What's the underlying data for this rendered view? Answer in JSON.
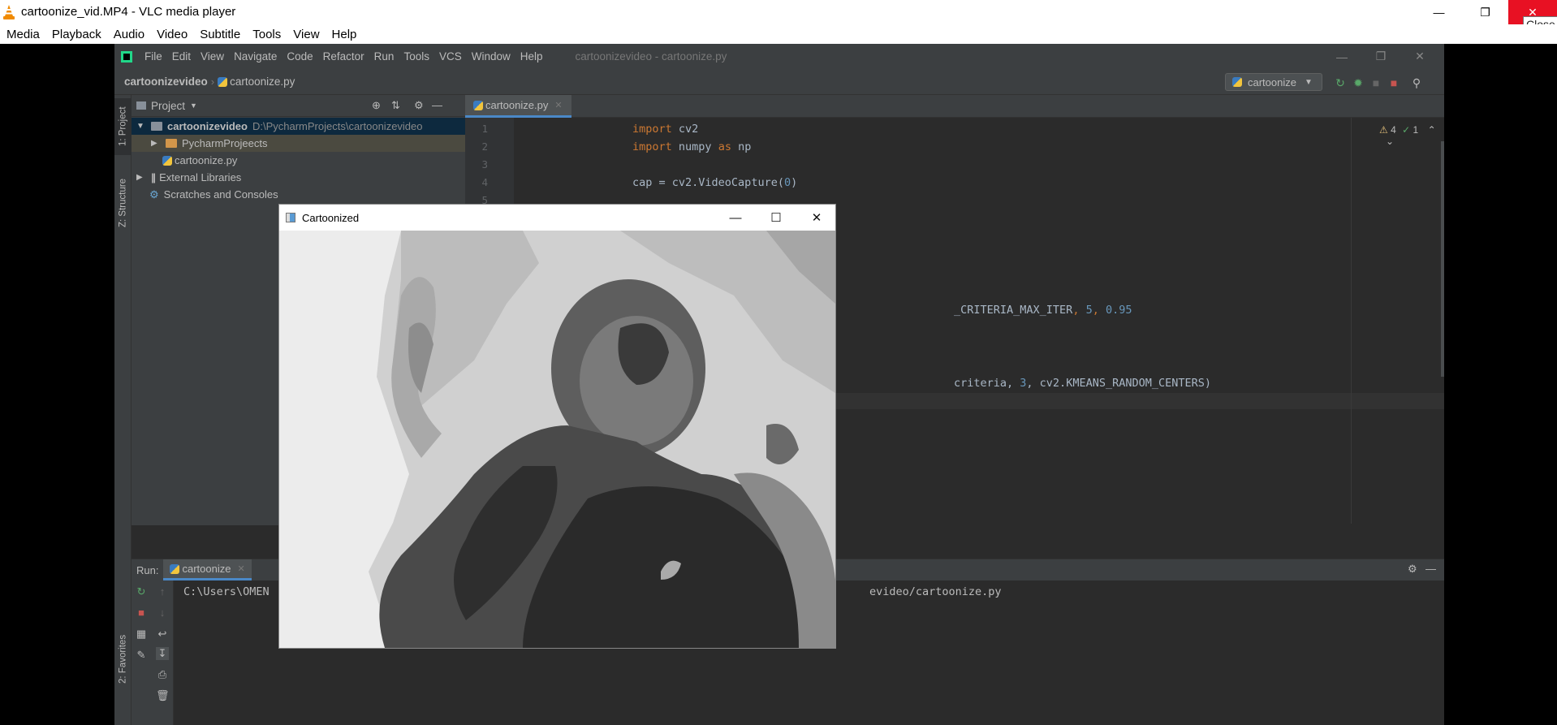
{
  "vlc": {
    "title": "cartoonize_vid.MP4 - VLC media player",
    "close_tooltip": "Close",
    "menu": [
      "Media",
      "Playback",
      "Audio",
      "Video",
      "Subtitle",
      "Tools",
      "View",
      "Help"
    ]
  },
  "pycharm": {
    "menu": [
      "File",
      "Edit",
      "View",
      "Navigate",
      "Code",
      "Refactor",
      "Run",
      "Tools",
      "VCS",
      "Window",
      "Help"
    ],
    "window_title": "cartoonizevideo - cartoonize.py",
    "breadcrumb": {
      "project": "cartoonizevideo",
      "file": "cartoonize.py"
    },
    "run_config": "cartoonize",
    "side_tabs": {
      "project": "1: Project",
      "structure": "Z: Structure",
      "favorites": "2: Favorites"
    },
    "project_panel": {
      "title": "Project",
      "root": {
        "name": "cartoonizevideo",
        "path": "D:\\PycharmProjects\\cartoonizevideo"
      },
      "folder": "PycharmProjeects",
      "file": "cartoonize.py",
      "external": "External Libraries",
      "scratches": "Scratches and Consoles"
    },
    "editor": {
      "tab": "cartoonize.py",
      "warnings": "4",
      "checks": "1",
      "line_numbers": [
        "1",
        "2",
        "3",
        "4",
        "5"
      ],
      "lines": {
        "l1_kw": "import",
        "l1_rest": " cv2",
        "l2_kw": "import",
        "l2_mid": " numpy ",
        "l2_as": "as",
        "l2_rest": " np",
        "l4_a": "cap = ",
        "l4_b": "cv2.VideoCapture(",
        "l4_num": "0",
        "l4_c": ")",
        "frag1_a": "_CRITERIA_MAX_IT",
        "frag1_b": "ER",
        "frag1_c": ", ",
        "frag1_n1": "5",
        "frag1_d": ", ",
        "frag1_n2": "0.95",
        "frag2_a": "criteria, ",
        "frag2_n": "3",
        "frag2_b": ", cv2.KMEANS_RANDOM_CENTERS)"
      }
    },
    "run_panel": {
      "label": "Run:",
      "tab": "cartoonize",
      "console_left": "C:\\Users\\OMEN",
      "console_right": "evideo/cartoonize.py"
    }
  },
  "cv_window": {
    "title": "Cartoonized"
  },
  "colors": {
    "vlc_close": "#e81123",
    "keyword": "#cc7832",
    "number": "#6897bb",
    "selection": "#0d293e"
  }
}
